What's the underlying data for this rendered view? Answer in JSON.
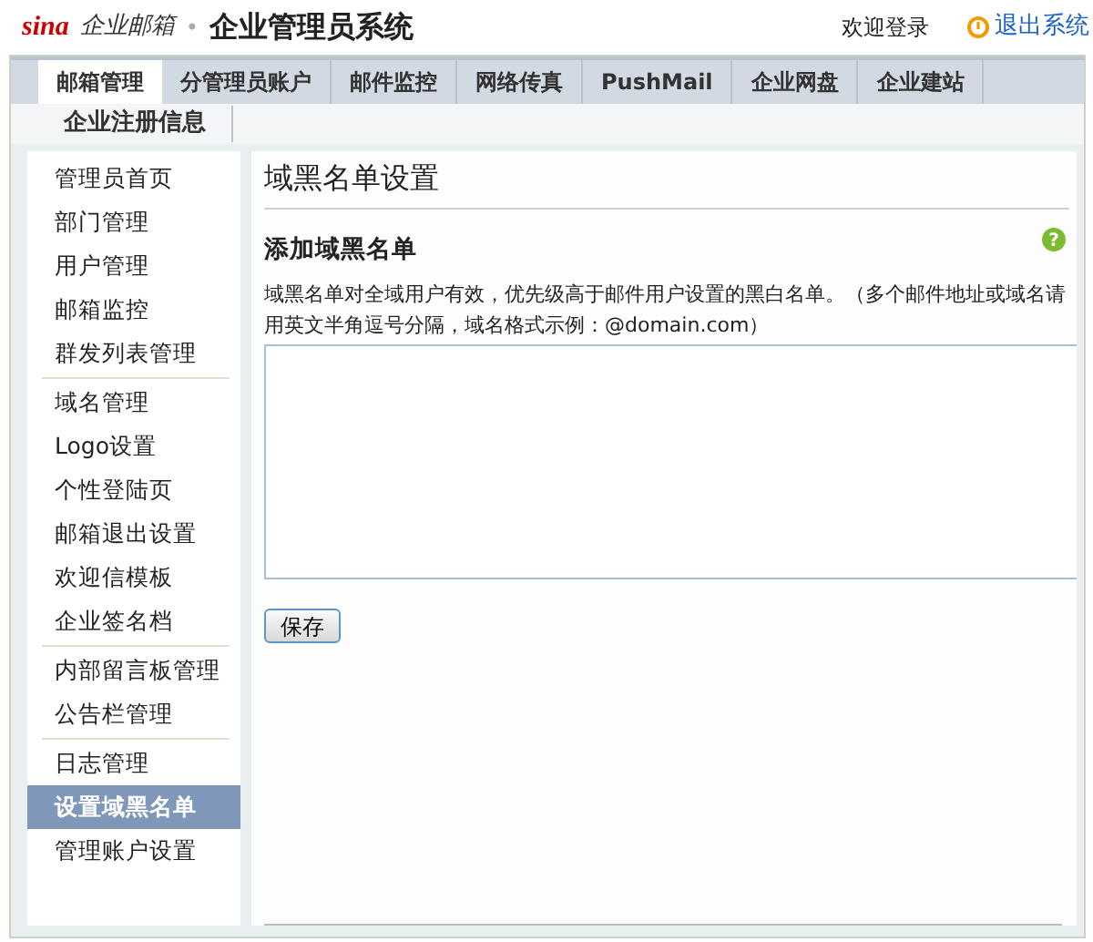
{
  "header": {
    "brand": "sina",
    "product": "企业邮箱",
    "separator": "•",
    "title": "企业管理员系统",
    "welcome": "欢迎登录",
    "logout": "退出系统"
  },
  "tabs": [
    {
      "label": "邮箱管理",
      "selected": true
    },
    {
      "label": "分管理员账户",
      "selected": false
    },
    {
      "label": "邮件监控",
      "selected": false
    },
    {
      "label": "网络传真",
      "selected": false
    },
    {
      "label": "PushMail",
      "selected": false
    },
    {
      "label": "企业网盘",
      "selected": false
    },
    {
      "label": "企业建站",
      "selected": false
    }
  ],
  "subtabs": [
    {
      "label": "企业注册信息",
      "selected": false
    }
  ],
  "sidebar": {
    "groups": [
      {
        "items": [
          {
            "label": "管理员首页",
            "selected": false
          },
          {
            "label": "部门管理",
            "selected": false
          },
          {
            "label": "用户管理",
            "selected": false
          },
          {
            "label": "邮箱监控",
            "selected": false
          },
          {
            "label": "群发列表管理",
            "selected": false
          }
        ]
      },
      {
        "items": [
          {
            "label": "域名管理",
            "selected": false
          },
          {
            "label": "Logo设置",
            "selected": false
          },
          {
            "label": "个性登陆页",
            "selected": false
          },
          {
            "label": "邮箱退出设置",
            "selected": false
          },
          {
            "label": "欢迎信模板",
            "selected": false
          },
          {
            "label": "企业签名档",
            "selected": false
          }
        ]
      },
      {
        "items": [
          {
            "label": "内部留言板管理",
            "selected": false
          },
          {
            "label": "公告栏管理",
            "selected": false
          }
        ]
      },
      {
        "items": [
          {
            "label": "日志管理",
            "selected": false
          },
          {
            "label": "设置域黑名单",
            "selected": true
          },
          {
            "label": "管理账户设置",
            "selected": false
          }
        ]
      }
    ]
  },
  "content": {
    "title": "域黑名单设置",
    "section": "添加域黑名单",
    "help": "?",
    "description": "域黑名单对全域用户有效，优先级高于邮件用户设置的黑白名单。（多个邮件地址或域名请用英文半角逗号分隔，域名格式示例：@domain.com）",
    "save_button": "保存"
  }
}
